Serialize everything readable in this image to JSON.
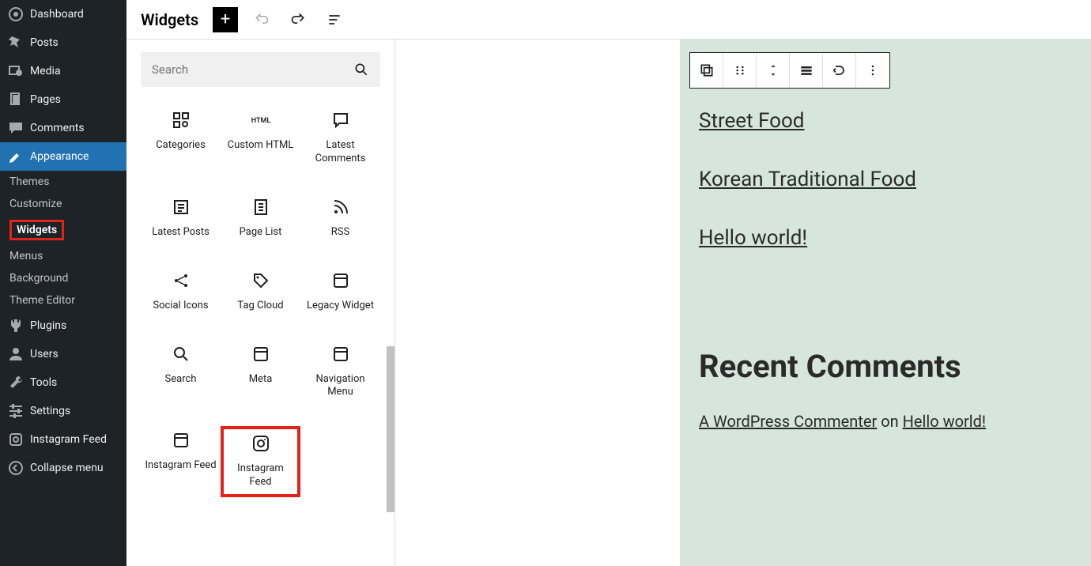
{
  "adminMenu": {
    "dashboard": "Dashboard",
    "posts": "Posts",
    "media": "Media",
    "pages": "Pages",
    "comments": "Comments",
    "appearance": "Appearance",
    "plugins": "Plugins",
    "users": "Users",
    "tools": "Tools",
    "settings": "Settings",
    "instagramFeed": "Instagram Feed",
    "collapse": "Collapse menu"
  },
  "appearanceSub": {
    "themes": "Themes",
    "customize": "Customize",
    "widgets": "Widgets",
    "menus": "Menus",
    "background": "Background",
    "themeEditor": "Theme Editor"
  },
  "topbar": {
    "title": "Widgets"
  },
  "inserter": {
    "searchPlaceholder": "Search",
    "blocks": {
      "categories": "Categories",
      "customHtml": "Custom HTML",
      "latestComments": "Latest Comments",
      "latestPosts": "Latest Posts",
      "pageList": "Page List",
      "rss": "RSS",
      "socialIcons": "Social Icons",
      "tagCloud": "Tag Cloud",
      "legacyWidget": "Legacy Widget",
      "search": "Search",
      "meta": "Meta",
      "navigationMenu": "Navigation Menu",
      "instagramFeed1": "Instagram Feed",
      "instagramFeed2": "Instagram Feed"
    }
  },
  "canvas": {
    "post1": "Street Food",
    "post2": "Korean Traditional Food",
    "post3": "Hello world!",
    "recentHeading": "Recent Comments",
    "commenter": "A WordPress Commenter",
    "on": " on ",
    "commentPost": "Hello world!"
  }
}
